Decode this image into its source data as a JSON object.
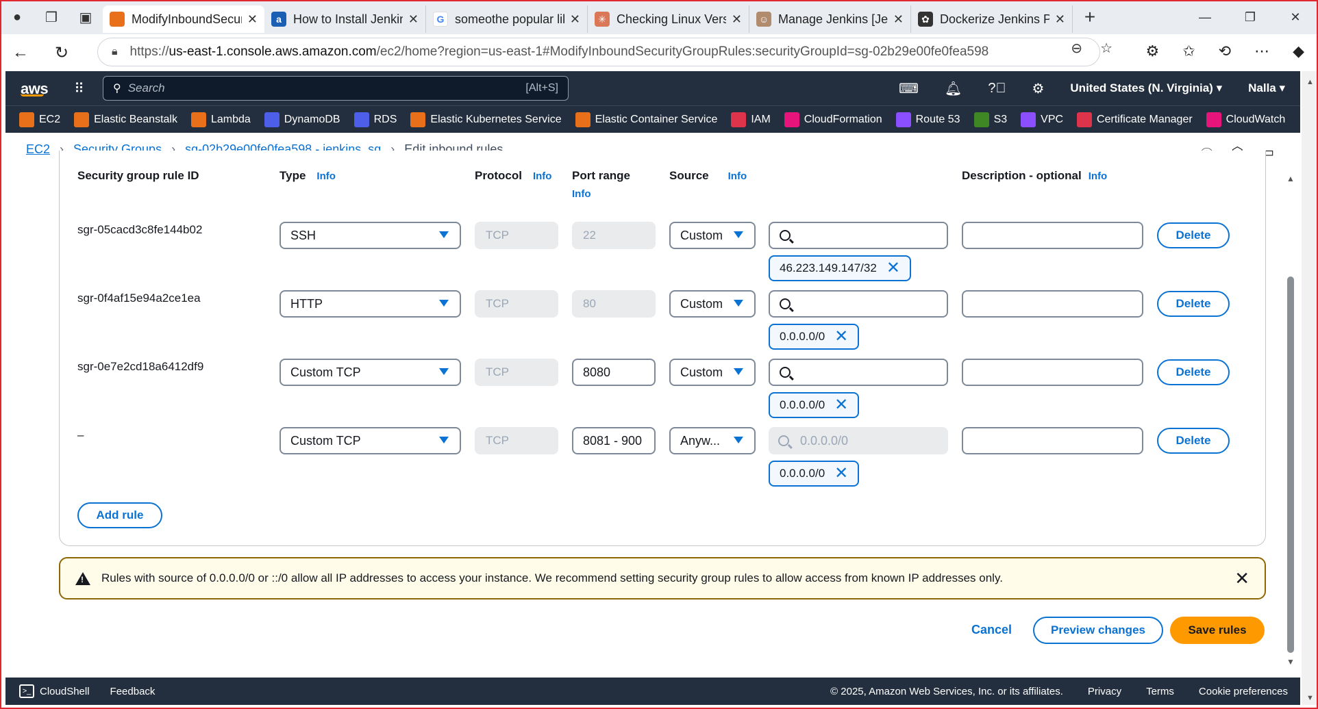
{
  "browser": {
    "tabs": [
      {
        "title": "ModifyInboundSecur",
        "fav_color": "#e8701a",
        "fav_glyph": "",
        "active": true
      },
      {
        "title": "How to Install Jenkins",
        "fav_color": "#1a5fb4",
        "fav_glyph": "a",
        "active": false
      },
      {
        "title": "someothe popular lik",
        "fav_color": "#ffffff",
        "fav_glyph": "G",
        "active": false
      },
      {
        "title": "Checking Linux Versic",
        "fav_color": "#d97757",
        "fav_glyph": "✳",
        "active": false
      },
      {
        "title": "Manage Jenkins [Jenk",
        "fav_color": "#b08b6e",
        "fav_glyph": "☺",
        "active": false
      },
      {
        "title": "Dockerize Jenkins Plu",
        "fav_color": "#333333",
        "fav_glyph": "✿",
        "active": false
      }
    ],
    "url_prefix": "https://",
    "url_host": "us-east-1.console.aws.amazon.com",
    "url_path": "/ec2/home?region=us-east-1#ModifyInboundSecurityGroupRules:securityGroupId=sg-02b29e00fe0fea598"
  },
  "aws": {
    "logo": "aws",
    "search_placeholder": "Search",
    "search_shortcut": "[Alt+S]",
    "region": "United States (N. Virginia) ▾",
    "user": "Nalla ▾",
    "favorites": [
      {
        "label": "EC2",
        "color": "#e8701a"
      },
      {
        "label": "Elastic Beanstalk",
        "color": "#e8701a"
      },
      {
        "label": "Lambda",
        "color": "#e8701a"
      },
      {
        "label": "DynamoDB",
        "color": "#4d5ee8"
      },
      {
        "label": "RDS",
        "color": "#4d5ee8"
      },
      {
        "label": "Elastic Kubernetes Service",
        "color": "#e8701a"
      },
      {
        "label": "Elastic Container Service",
        "color": "#e8701a"
      },
      {
        "label": "IAM",
        "color": "#dd344c"
      },
      {
        "label": "CloudFormation",
        "color": "#e7157b"
      },
      {
        "label": "Route 53",
        "color": "#8c4fff"
      },
      {
        "label": "S3",
        "color": "#3f8624"
      },
      {
        "label": "VPC",
        "color": "#8c4fff"
      },
      {
        "label": "Certificate Manager",
        "color": "#dd344c"
      },
      {
        "label": "CloudWatch",
        "color": "#e7157b"
      }
    ]
  },
  "breadcrumb": {
    "items": [
      "EC2",
      "Security Groups",
      "sg-02b29e00fe0fea598 - jenkins_sg"
    ],
    "current": "Edit inbound rules"
  },
  "columns": {
    "rule_id": "Security group rule ID",
    "type": "Type",
    "protocol": "Protocol",
    "port_range": "Port range",
    "source": "Source",
    "description": "Description - optional",
    "info": "Info"
  },
  "rules": [
    {
      "id": "sgr-05cacd3c8fe144b02",
      "type": "SSH",
      "protocol": "TCP",
      "port": "22",
      "port_editable": false,
      "source": "Custom",
      "search_value": "",
      "search_disabled": false,
      "token": "46.223.149.147/32",
      "description": ""
    },
    {
      "id": "sgr-0f4af15e94a2ce1ea",
      "type": "HTTP",
      "protocol": "TCP",
      "port": "80",
      "port_editable": false,
      "source": "Custom",
      "search_value": "",
      "search_disabled": false,
      "token": "0.0.0.0/0",
      "description": ""
    },
    {
      "id": "sgr-0e7e2cd18a6412df9",
      "type": "Custom TCP",
      "protocol": "TCP",
      "port": "8080",
      "port_editable": true,
      "source": "Custom",
      "search_value": "",
      "search_disabled": false,
      "token": "0.0.0.0/0",
      "description": ""
    },
    {
      "id": "–",
      "type": "Custom TCP",
      "protocol": "TCP",
      "port": "8081 - 900",
      "port_editable": true,
      "source": "Anyw...",
      "search_value": "0.0.0.0/0",
      "search_disabled": true,
      "token": "0.0.0.0/0",
      "description": ""
    }
  ],
  "buttons": {
    "delete": "Delete",
    "add_rule": "Add rule",
    "cancel": "Cancel",
    "preview": "Preview changes",
    "save": "Save rules"
  },
  "warning": "Rules with source of 0.0.0.0/0 or ::/0 allow all IP addresses to access your instance. We recommend setting security group rules to allow access from known IP addresses only.",
  "footer": {
    "cloudshell": "CloudShell",
    "feedback": "Feedback",
    "copyright": "© 2025, Amazon Web Services, Inc. or its affiliates.",
    "links": [
      "Privacy",
      "Terms",
      "Cookie preferences"
    ]
  }
}
